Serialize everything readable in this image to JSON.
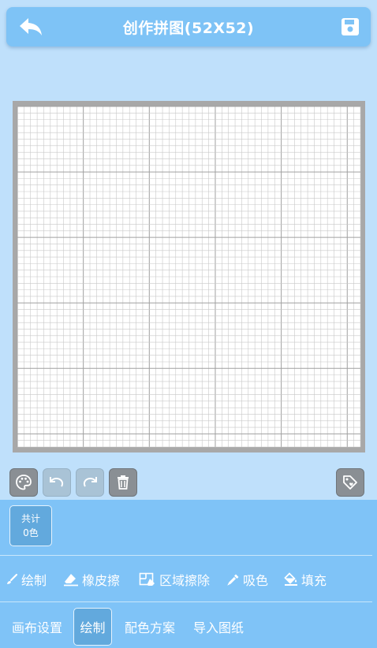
{
  "header": {
    "title": "创作拼图(52X52)",
    "back_icon": "back-arrow-icon",
    "save_icon": "save-floppy-icon"
  },
  "canvas": {
    "grid_cols": 52,
    "grid_rows": 52,
    "background": "#ffffff",
    "grid_color": "#c8c8c8",
    "frame_color": "#a8a8a8"
  },
  "toolbar": {
    "palette_icon": "palette-icon",
    "undo_icon": "undo-icon",
    "redo_icon": "redo-icon",
    "delete_icon": "trash-icon",
    "tag_icon": "tag-icon"
  },
  "color_count": {
    "line1": "共计",
    "line2": "0色"
  },
  "draw_tools": [
    {
      "label": "绘制",
      "icon": "brush-icon"
    },
    {
      "label": "橡皮擦",
      "icon": "eraser-icon"
    },
    {
      "label": "区域擦除",
      "icon": "area-erase-icon"
    },
    {
      "label": "吸色",
      "icon": "eyedropper-icon"
    },
    {
      "label": "填充",
      "icon": "fill-bucket-icon"
    }
  ],
  "tabs": [
    {
      "label": "画布设置"
    },
    {
      "label": "绘制",
      "active": true
    },
    {
      "label": "配色方案"
    },
    {
      "label": "导入图纸"
    }
  ],
  "colors": {
    "background": "#bfe0fb",
    "header": "#7ec3f6",
    "panel": "#7fc3f7",
    "active_tab": "#62a9dd"
  }
}
